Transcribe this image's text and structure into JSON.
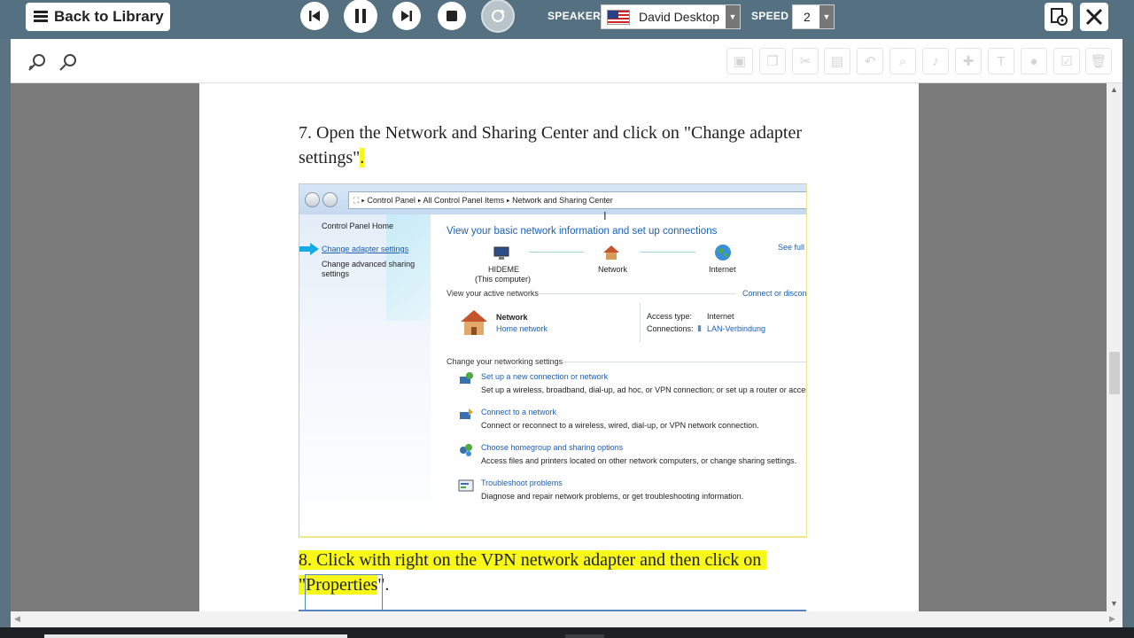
{
  "topbar": {
    "back_label": "Back to Library",
    "speaker_label": "SPEAKER",
    "speaker_value": "David Desktop",
    "speed_label": "SPEED",
    "speed_value": "2"
  },
  "document": {
    "step7_text": "7. Open the Network and Sharing Center and click on \"Change adapter settings\"",
    "step7_end": ".",
    "step8_line1": "8. Click with right on the VPN network adapter and then click on",
    "step8_line2_pre": "\"",
    "step8_word": "Properties",
    "step8_line2_post": "\"."
  },
  "screenshot": {
    "breadcrumb": {
      "a": "Control Panel",
      "b": "All Control Panel Items",
      "c": "Network and Sharing Center"
    },
    "sidebar": {
      "home": "Control Panel Home",
      "change_adapter": "Change adapter settings",
      "change_sharing_1": "Change advanced sharing",
      "change_sharing_2": "settings"
    },
    "heading": "View your basic network information and set up connections",
    "see_full": "See full m",
    "map": {
      "computer": "HIDEME",
      "computer_sub": "(This computer)",
      "network": "Network",
      "internet": "Internet"
    },
    "active_label": "View your active networks",
    "connect_link": "Connect or disconne",
    "active": {
      "name": "Network",
      "type": "Home network",
      "access_label": "Access type:",
      "access_value": "Internet",
      "conn_label": "Connections:",
      "conn_value": "LAN-Verbindung"
    },
    "change_settings_label": "Change your networking settings",
    "tasks": [
      {
        "title": "Set up a new connection or network",
        "desc": "Set up a wireless, broadband, dial-up, ad hoc, or VPN connection; or set up a router or access po"
      },
      {
        "title": "Connect to a network",
        "desc": "Connect or reconnect to a wireless, wired, dial-up, or VPN network connection."
      },
      {
        "title": "Choose homegroup and sharing options",
        "desc": "Access files and printers located on other network computers, or change sharing settings."
      },
      {
        "title": "Troubleshoot problems",
        "desc": "Diagnose and repair network problems, or get troubleshooting information."
      }
    ]
  },
  "colors": {
    "topbar": "#547081",
    "highlight": "#f7f71a",
    "link": "#1a5fb4"
  }
}
